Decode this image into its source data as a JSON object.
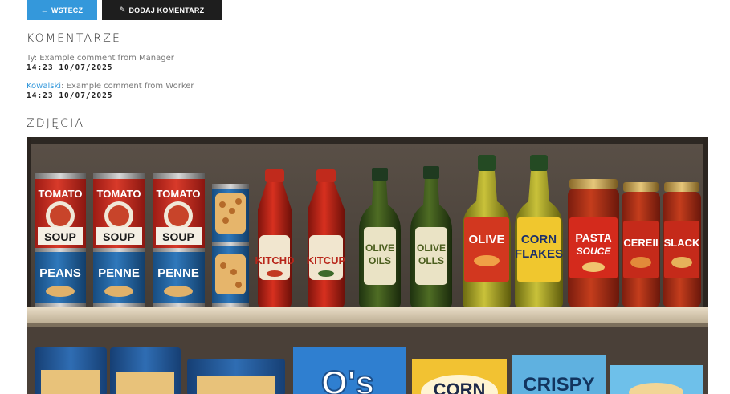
{
  "toolbar": {
    "back_label": "WSTECZ",
    "add_comment_label": "DODAJ KOMENTARZ"
  },
  "comments": {
    "title": "KOMENTARZE",
    "items": [
      {
        "author": "Ty",
        "separator": ":",
        "text": " Example comment from Manager",
        "date": "14:23 10/07/2025"
      },
      {
        "author": "Kowalski",
        "separator": ":",
        "text": " Example comment from Worker",
        "date": "14:23 10/07/2025"
      }
    ]
  },
  "photos": {
    "title": "ZDJĘCIA",
    "image": {
      "top_shelf_labels": [
        {
          "line1": "TOMATO",
          "line2": "SOUP",
          "line3": "PEANS"
        },
        {
          "line1": "TOMATO",
          "line2": "SOUP",
          "line3": "PENNE"
        },
        {
          "line1": "TOMATO",
          "line2": "SOUP",
          "line3": "PENNE"
        }
      ],
      "ketchup_labels": [
        "KITCHD",
        "KITCUP"
      ],
      "oil_labels": [
        "OLIVE OILS",
        "OLIVE OILS"
      ],
      "big_bottle_labels": [
        {
          "line1": "OLIVE",
          "line2": ""
        },
        {
          "line1": "CORN",
          "line2": "FLAKES"
        }
      ],
      "jar_labels": [
        {
          "line1": "PASTA",
          "line2": "SOUCE"
        },
        {
          "line1": "CEREII",
          "line2": ""
        },
        {
          "line1": "SLACK",
          "line2": ""
        }
      ],
      "box_labels": [
        "O's",
        "CORN",
        "CRISPY"
      ]
    }
  }
}
